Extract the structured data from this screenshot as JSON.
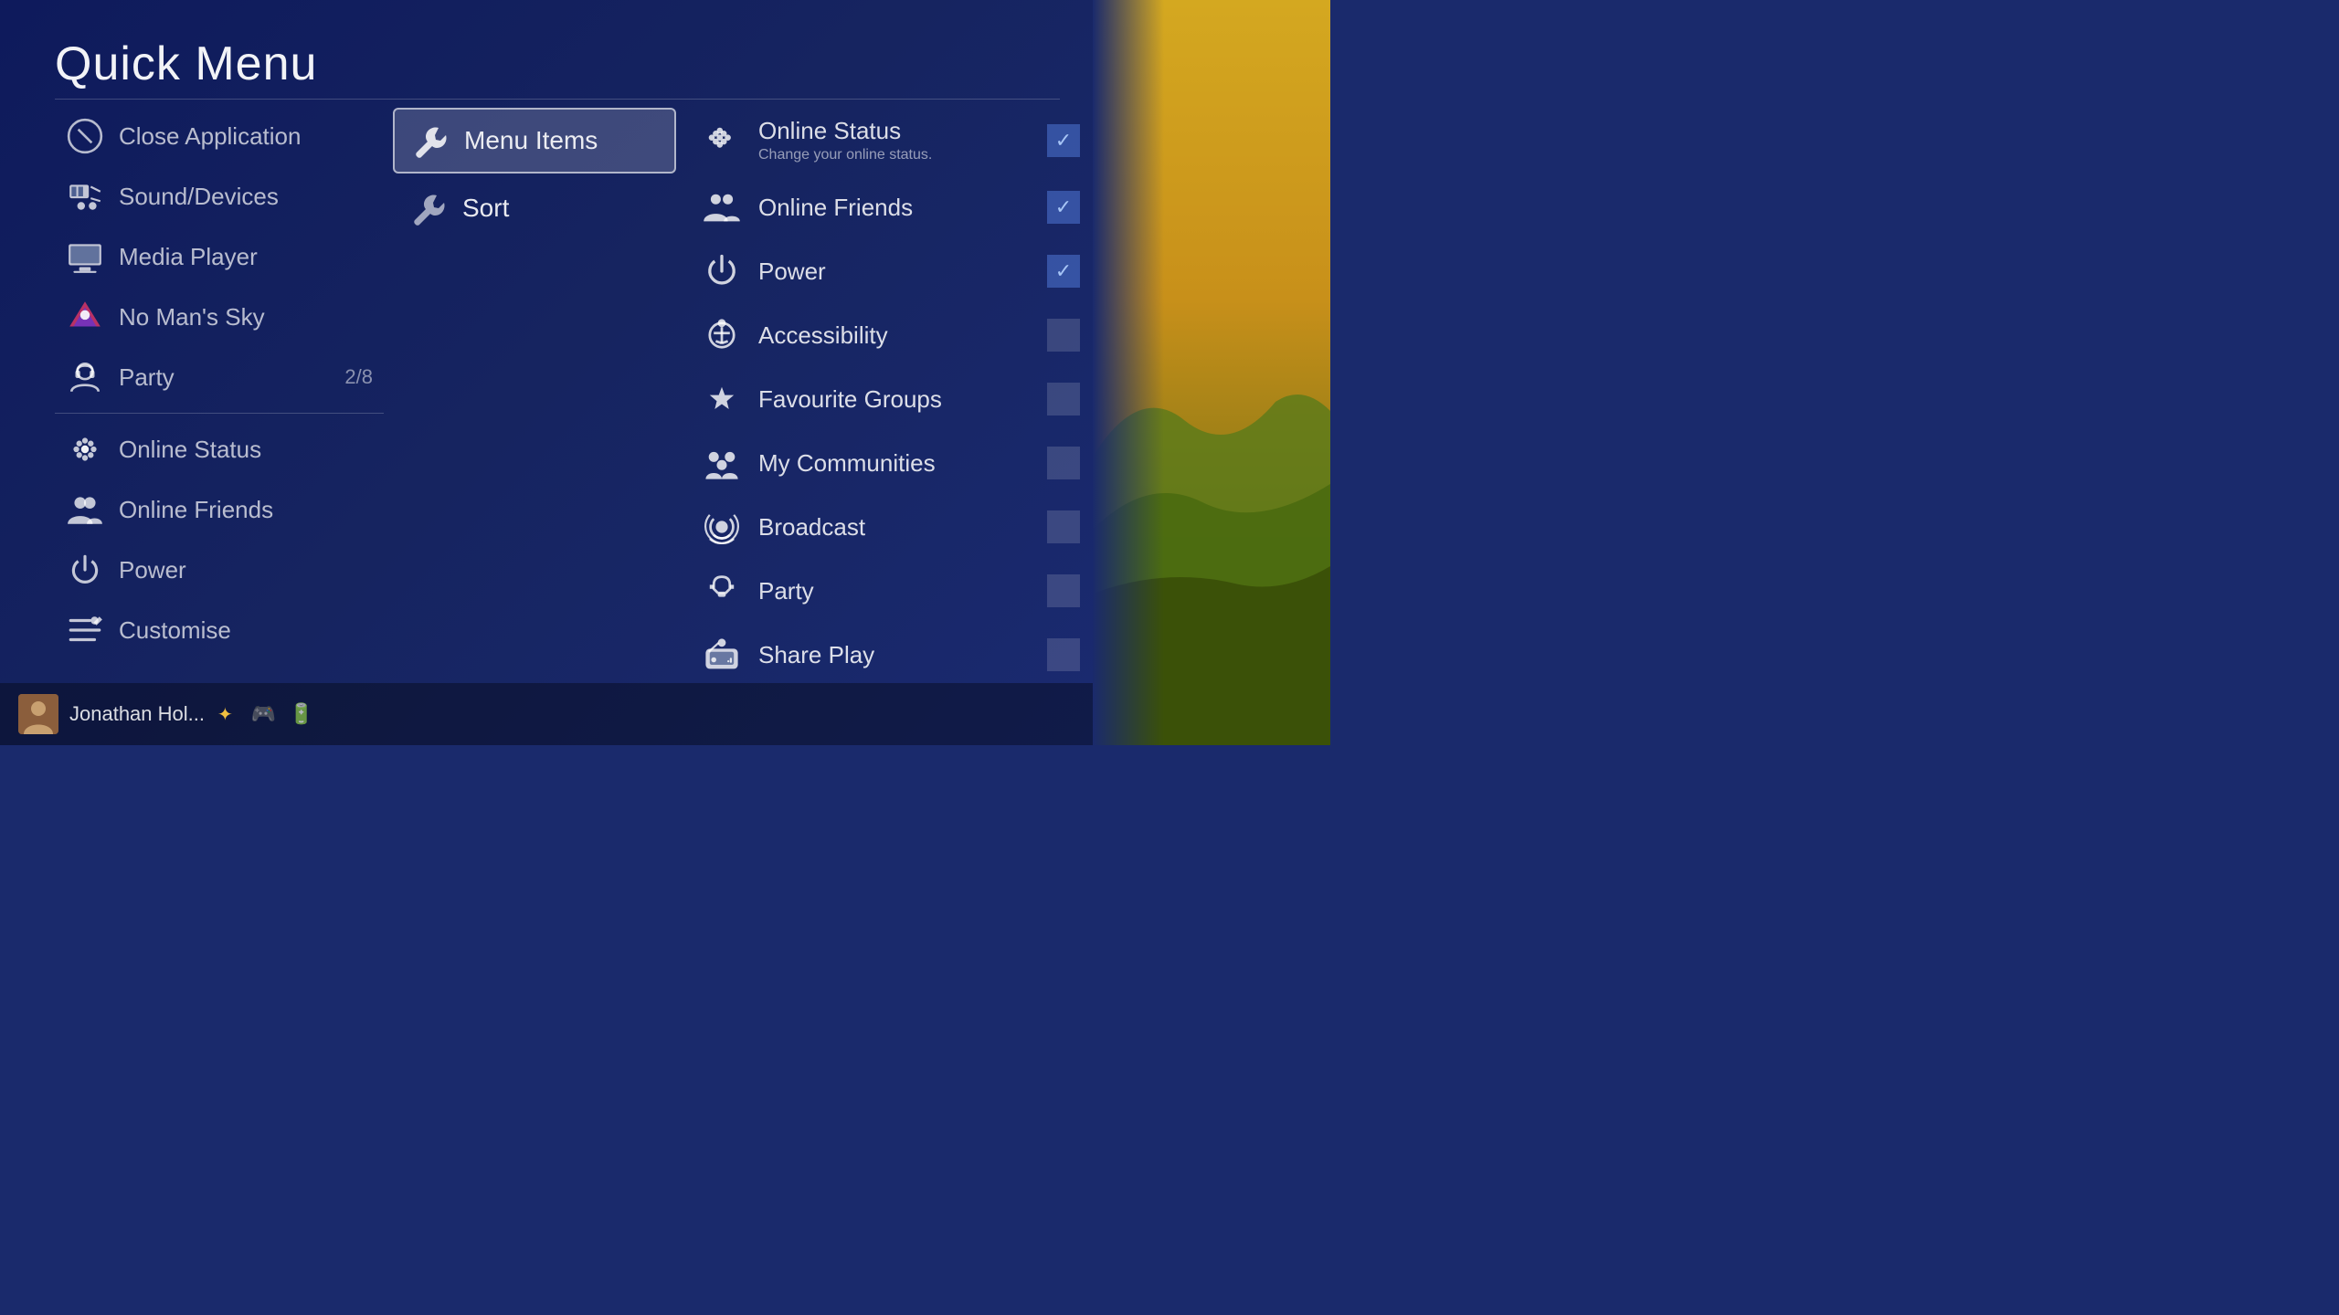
{
  "page": {
    "title": "Quick Menu"
  },
  "left_menu": {
    "items": [
      {
        "id": "close-application",
        "label": "Close Application",
        "icon": "close-app-icon",
        "badge": ""
      },
      {
        "id": "sound-devices",
        "label": "Sound/Devices",
        "icon": "sound-icon",
        "badge": ""
      },
      {
        "id": "media-player",
        "label": "Media Player",
        "icon": "media-player-icon",
        "badge": ""
      },
      {
        "id": "no-mans-sky",
        "label": "No Man's Sky",
        "icon": "game-icon",
        "badge": ""
      },
      {
        "id": "party",
        "label": "Party",
        "icon": "party-icon",
        "badge": "2/8"
      },
      {
        "id": "online-status",
        "label": "Online Status",
        "icon": "online-status-icon",
        "badge": ""
      },
      {
        "id": "online-friends",
        "label": "Online Friends",
        "icon": "online-friends-icon",
        "badge": ""
      },
      {
        "id": "power",
        "label": "Power",
        "icon": "power-icon",
        "badge": ""
      },
      {
        "id": "customise",
        "label": "Customise",
        "icon": "customise-icon",
        "badge": ""
      }
    ]
  },
  "middle_menu": {
    "items": [
      {
        "id": "menu-items",
        "label": "Menu Items",
        "icon": "wrench-icon",
        "active": true
      },
      {
        "id": "sort",
        "label": "Sort",
        "icon": "wrench-icon",
        "active": false
      }
    ]
  },
  "right_menu": {
    "items": [
      {
        "id": "online-status-r",
        "label": "Online Status",
        "sublabel": "Change your online status.",
        "icon": "online-status-r-icon",
        "checked": true
      },
      {
        "id": "online-friends-r",
        "label": "Online Friends",
        "sublabel": "",
        "icon": "online-friends-r-icon",
        "checked": true
      },
      {
        "id": "power-r",
        "label": "Power",
        "sublabel": "",
        "icon": "power-r-icon",
        "checked": true
      },
      {
        "id": "accessibility-r",
        "label": "Accessibility",
        "sublabel": "",
        "icon": "accessibility-r-icon",
        "checked": false
      },
      {
        "id": "favourite-groups-r",
        "label": "Favourite Groups",
        "sublabel": "",
        "icon": "favourite-groups-r-icon",
        "checked": false
      },
      {
        "id": "my-communities-r",
        "label": "My Communities",
        "sublabel": "",
        "icon": "my-communities-r-icon",
        "checked": false
      },
      {
        "id": "broadcast-r",
        "label": "Broadcast",
        "sublabel": "",
        "icon": "broadcast-r-icon",
        "checked": false
      },
      {
        "id": "party-r",
        "label": "Party",
        "sublabel": "",
        "icon": "party-r-icon",
        "checked": false
      },
      {
        "id": "share-play-r",
        "label": "Share Play",
        "sublabel": "",
        "icon": "share-play-r-icon",
        "checked": false
      }
    ]
  },
  "bottom_bar": {
    "user_name": "Jonathan Hol...",
    "ps_plus": "PS+",
    "controller": "controller",
    "battery": "battery"
  }
}
